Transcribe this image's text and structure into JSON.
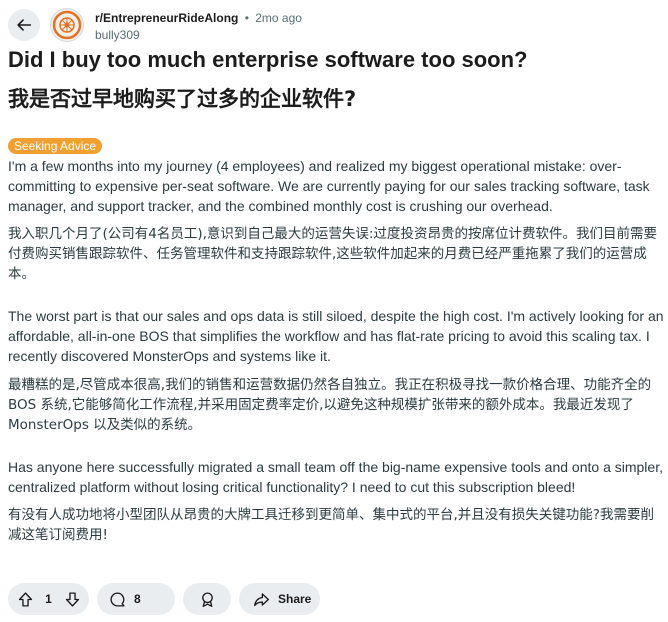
{
  "post": {
    "subreddit": "r/EntrepreneurRideAlong",
    "separator": "•",
    "age": "2mo ago",
    "author": "bully309",
    "title_en": "Did I buy too much enterprise software too soon?",
    "title_zh": "我是否过早地购买了过多的企业软件?",
    "flair": "Seeking Advice",
    "paragraphs": [
      "I'm a few months into my journey (4 employees) and realized my biggest operational mistake: over-committing to expensive per-seat software. We are currently paying for our sales tracking software, task manager, and support tracker, and the combined monthly cost is crushing our overhead.",
      "我入职几个月了(公司有4名员工),意识到自己最大的运营失误:过度投资昂贵的按席位计费软件。我们目前需要付费购买销售跟踪软件、任务管理软件和支持跟踪软件,这些软件加起来的月费已经严重拖累了我们的运营成本。",
      "The worst part is that our sales and ops data is still siloed, despite the high cost. I'm actively looking for an affordable, all-in-one BOS that simplifies the workflow and has flat-rate pricing to avoid this scaling tax. I recently discovered MonsterOps and systems like it.",
      "最糟糕的是,尽管成本很高,我们的销售和运营数据仍然各自独立。我正在积极寻找一款价格合理、功能齐全的 BOS 系统,它能够简化工作流程,并采用固定费率定价,以避免这种规模扩张带来的额外成本。我最近发现了 MonsterOps 以及类似的系统。",
      "Has anyone here successfully migrated a small team off the big-name expensive tools and onto a simpler, centralized platform without losing critical functionality? I need to cut this subscription bleed!",
      "有没有人成功地将小型团队从昂贵的大牌工具迁移到更简单、集中式的平台,并且没有损失关键功能?我需要削减这笔订阅费用!"
    ]
  },
  "actions": {
    "score": "1",
    "comments": "8",
    "share_label": "Share"
  },
  "icons": {
    "back": "arrow-left-icon",
    "upvote": "upvote-arrow-icon",
    "downvote": "downvote-arrow-icon",
    "comment": "comment-bubble-icon",
    "award": "award-icon",
    "share": "share-arrow-icon"
  },
  "colors": {
    "flair_bg": "#f0a030",
    "pill_bg": "#eaedef",
    "meta_text": "#576f76"
  }
}
